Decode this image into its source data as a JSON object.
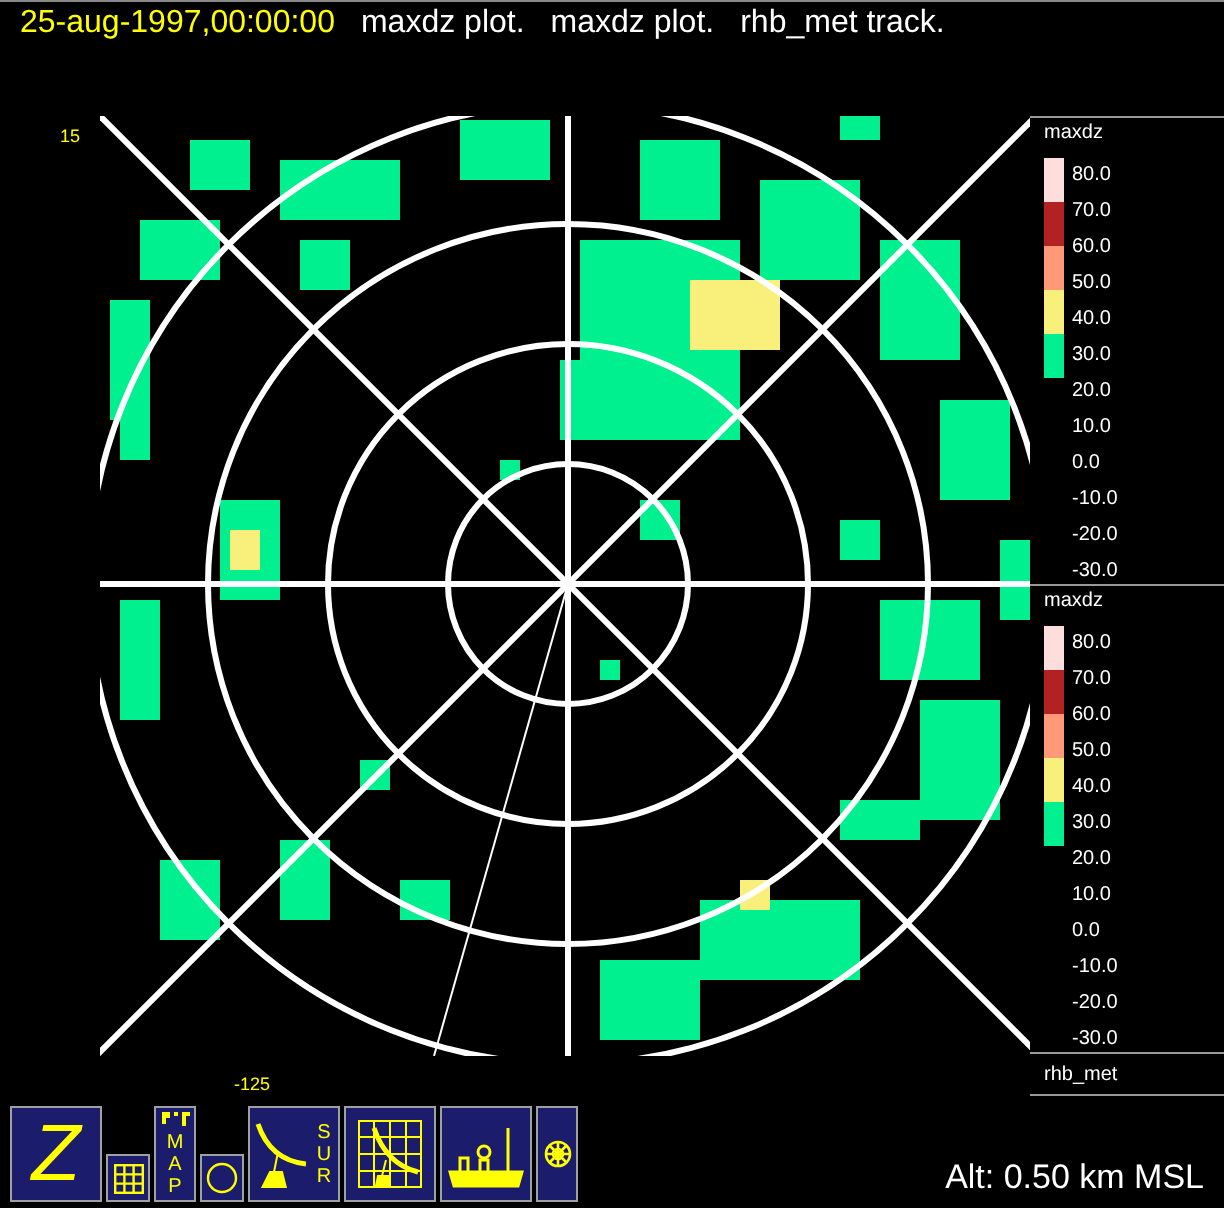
{
  "header": {
    "timestamp": "25-aug-1997,00:00:00",
    "titles": [
      "maxdz plot.",
      "maxdz plot.",
      "rhb_met track."
    ]
  },
  "plot": {
    "top_left_label": "15",
    "bottom_label": "-125"
  },
  "legends": [
    {
      "title": "maxdz",
      "bands": [
        {
          "color": "#ffdddd"
        },
        {
          "color": "#b22222"
        },
        {
          "color": "#ff9977"
        },
        {
          "color": "#f8f07a"
        },
        {
          "color": "#00f090"
        }
      ],
      "labels": [
        "80.0",
        "70.0",
        "60.0",
        "50.0",
        "40.0",
        "30.0",
        "20.0",
        "10.0",
        "0.0",
        "-10.0",
        "-20.0",
        "-30.0"
      ]
    },
    {
      "title": "maxdz",
      "bands": [
        {
          "color": "#ffdddd"
        },
        {
          "color": "#b22222"
        },
        {
          "color": "#ff9977"
        },
        {
          "color": "#f8f07a"
        },
        {
          "color": "#00f090"
        }
      ],
      "labels": [
        "80.0",
        "70.0",
        "60.0",
        "50.0",
        "40.0",
        "30.0",
        "20.0",
        "10.0",
        "0.0",
        "-10.0",
        "-20.0",
        "-30.0"
      ]
    }
  ],
  "track": {
    "name": "rhb_met"
  },
  "toolbar": [
    {
      "kind": "letter",
      "label": "Z"
    },
    {
      "kind": "grid"
    },
    {
      "kind": "map",
      "label": "MAP"
    },
    {
      "kind": "circle"
    },
    {
      "kind": "surveillance",
      "label": "SUR"
    },
    {
      "kind": "dish-grid"
    },
    {
      "kind": "ship"
    },
    {
      "kind": "wheel"
    }
  ],
  "altitude": "Alt: 0.50 km MSL"
}
